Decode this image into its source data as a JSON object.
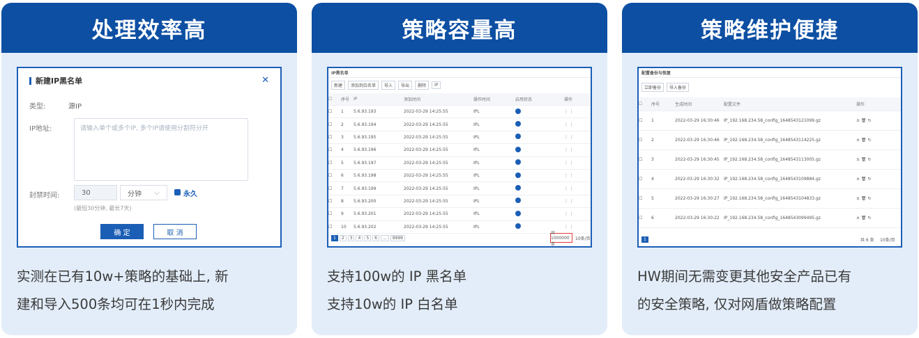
{
  "cards": [
    {
      "title": "处理效率高",
      "desc_lines": [
        "实测在已有10w+策略的基础上, 新",
        "建和导入500条均可在1秒内完成"
      ],
      "dialog": {
        "title": "新建IP黑名单",
        "type_label": "类型:",
        "type_value": "源IP",
        "ip_label": "IP地址:",
        "ip_placeholder": "请输入单个或多个IP, 多个IP请使用分割符分开",
        "time_label": "封禁时间:",
        "time_value": "30",
        "unit_value": "分钟",
        "forever_label": "永久",
        "hint": "(最短30分钟, 最长7天)",
        "ok_label": "确 定",
        "cancel_label": "取 消"
      }
    },
    {
      "title": "策略容量高",
      "desc_lines": [
        "支持100w的 IP 黑名单",
        "支持10w的 IP 白名单"
      ],
      "table": {
        "title": "IP黑名单",
        "toolbar": [
          "新建",
          "添加到白名单",
          "导入",
          "导出",
          "删除",
          "IP"
        ],
        "headers": [
          "序号",
          "IP",
          "添加时间",
          "操作时间",
          "启用状态",
          "操作"
        ],
        "rows": [
          "1",
          "2",
          "3",
          "4",
          "5",
          "6",
          "7",
          "8",
          "9",
          "10"
        ],
        "ips": [
          "5.6.93.193",
          "5.6.93.194",
          "5.6.93.195",
          "5.6.93.196",
          "5.6.93.197",
          "5.6.93.198",
          "5.6.93.199",
          "5.6.93.200",
          "5.6.93.201",
          "5.6.93.202"
        ],
        "time": "2022-03-29 14:25:55",
        "pages": [
          "1",
          "2",
          "3",
          "4",
          "5",
          "6",
          "...",
          "9999"
        ],
        "total": "共 1000000 条",
        "per_page": "10条/页"
      }
    },
    {
      "title": "策略维护便捷",
      "desc_lines": [
        "HW期间无需变更其他安全产品已有",
        "的安全策略, 仅对网盾做策略配置"
      ],
      "table": {
        "title": "配置备份与恢复",
        "toolbar": [
          "立即备份",
          "导入备份"
        ],
        "headers": [
          "序号",
          "生成时间",
          "配置文件",
          "操作"
        ],
        "rows": [
          {
            "no": "1",
            "time": "2022-03-29 16:30:46",
            "file": "IP_192.168.234.58_config_1648543121099.gz"
          },
          {
            "no": "2",
            "time": "2022-03-29 16:30:46",
            "file": "IP_192.168.234.58_config_1648543114225.gz"
          },
          {
            "no": "3",
            "time": "2022-03-29 16:30:45",
            "file": "IP_192.168.234.58_config_1648543113005.gz"
          },
          {
            "no": "4",
            "time": "2022-03-29 16:30:32",
            "file": "IP_192.168.234.58_config_1648543109884.gz"
          },
          {
            "no": "5",
            "time": "2022-03-29 16:30:27",
            "file": "IP_192.168.234.58_config_1648543104833.gz"
          },
          {
            "no": "6",
            "time": "2022-03-29 16:30:22",
            "file": "IP_192.168.234.58_config_1648543099495.gz"
          }
        ],
        "pages": [
          "1"
        ],
        "total": "共 6 条",
        "per_page": "10条/页"
      }
    }
  ],
  "colors": {
    "accent": "#0d4fa3",
    "card_bg": "#e3edf9",
    "highlight": "#e03a3a"
  }
}
